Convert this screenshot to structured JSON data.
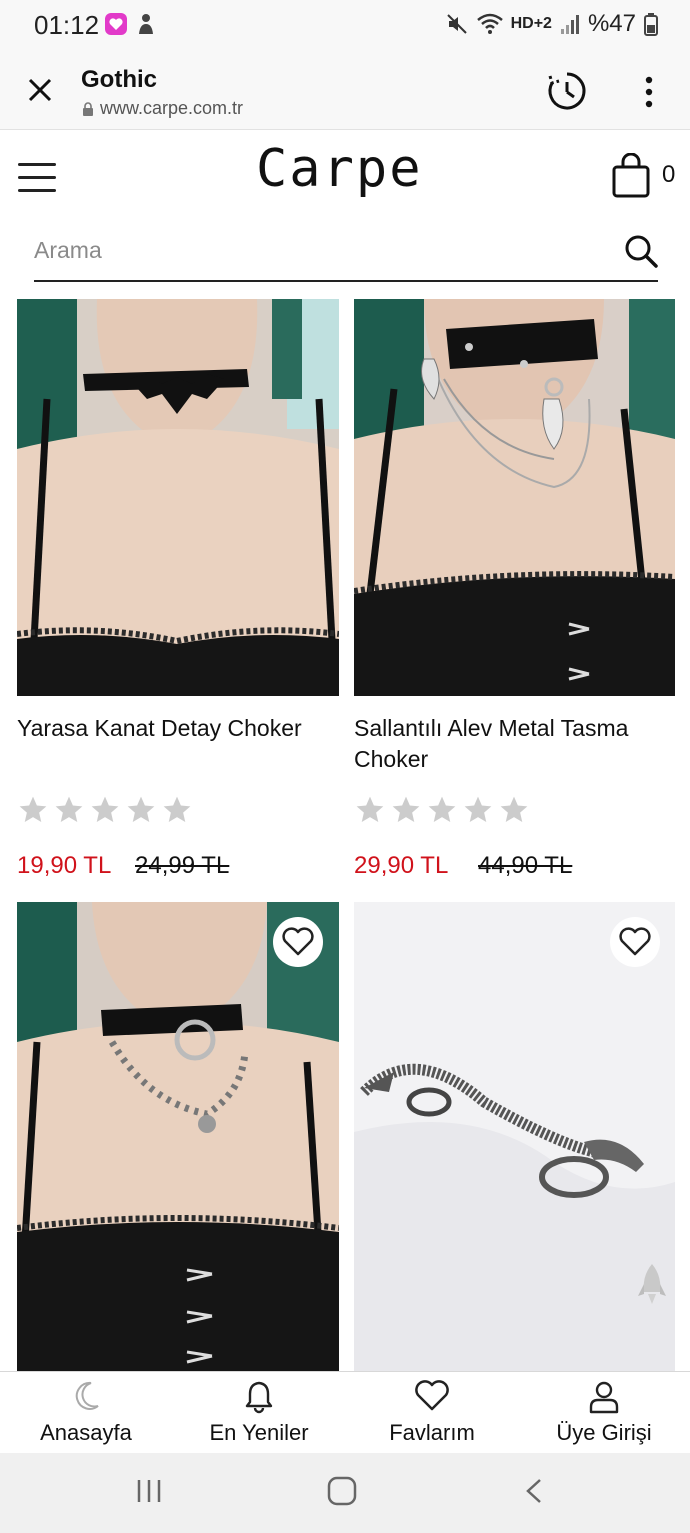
{
  "status_bar": {
    "time": "01:12",
    "network": "HD+2",
    "battery": "%47"
  },
  "browser": {
    "title": "Gothic",
    "url": "www.carpe.com.tr"
  },
  "site": {
    "logo": "Carpe",
    "cart_count": "0",
    "search_placeholder": "Arama"
  },
  "products": [
    {
      "name": "Yarasa Kanat Detay Choker",
      "price": "19,90 TL",
      "old_price": "24,99 TL",
      "rating": 0
    },
    {
      "name": "Sallantılı Alev Metal Tasma Choker",
      "price": "29,90 TL",
      "old_price": "44,90 TL",
      "rating": 0
    }
  ],
  "bottom_nav": [
    {
      "label": "Anasayfa",
      "icon": "moon-icon"
    },
    {
      "label": "En Yeniler",
      "icon": "bell-icon"
    },
    {
      "label": "Favlarım",
      "icon": "heart-icon"
    },
    {
      "label": "Üye Girişi",
      "icon": "user-icon"
    }
  ],
  "colors": {
    "price_red": "#d0121b",
    "star_gray": "#cccccc"
  }
}
